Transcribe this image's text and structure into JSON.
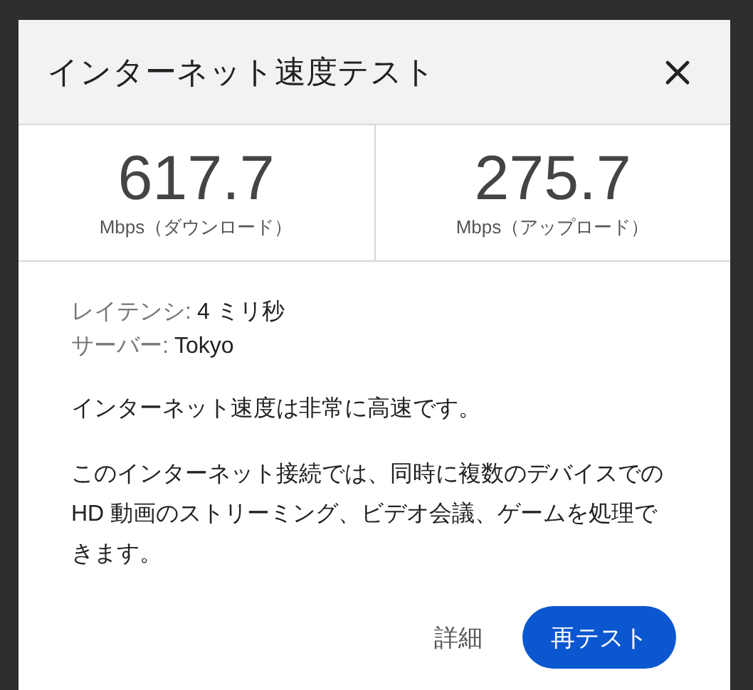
{
  "dialog": {
    "title": "インターネット速度テスト",
    "stats": [
      {
        "value": "617.7",
        "unit": "Mbps（ダウンロード）"
      },
      {
        "value": "275.7",
        "unit": "Mbps（アップロード）"
      }
    ],
    "details": [
      {
        "label": "レイテンシ:",
        "value": "4 ミリ秒"
      },
      {
        "label": "サーバー:",
        "value": "Tokyo"
      }
    ],
    "summary": "インターネット速度は非常に高速です。",
    "description": "このインターネット接続では、同時に複数のデバイスでの HD 動画のストリーミング、ビデオ会議、ゲームを処理できます。",
    "buttons": [
      {
        "label": "詳細",
        "kind": "text"
      },
      {
        "label": "再テスト",
        "kind": "primary"
      }
    ]
  }
}
